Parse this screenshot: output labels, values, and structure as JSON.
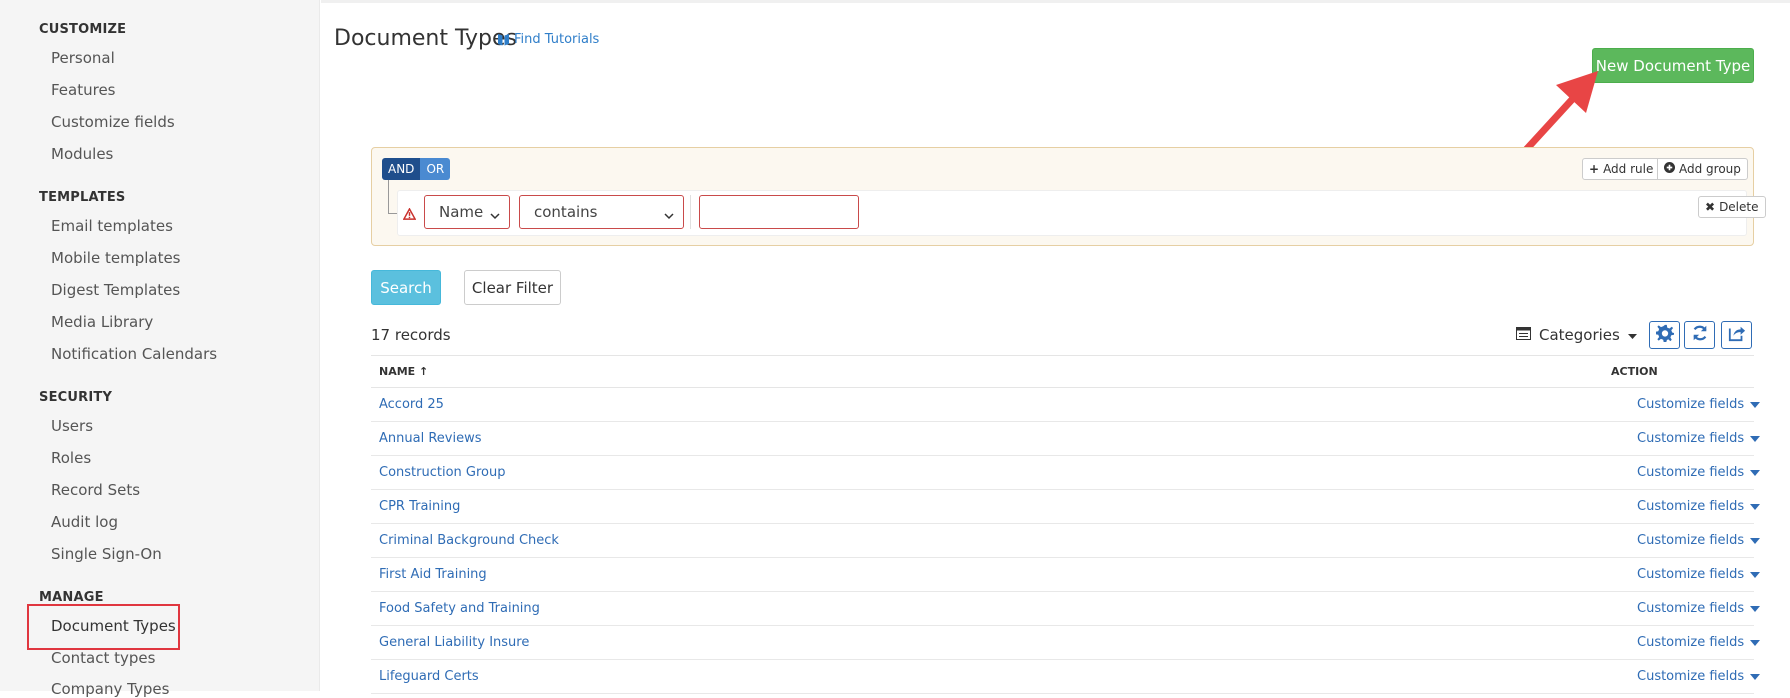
{
  "sidebar": {
    "sections": [
      {
        "heading": "CUSTOMIZE",
        "items": [
          "Personal",
          "Features",
          "Customize fields",
          "Modules"
        ]
      },
      {
        "heading": "TEMPLATES",
        "items": [
          "Email templates",
          "Mobile templates",
          "Digest Templates",
          "Media Library",
          "Notification Calendars"
        ]
      },
      {
        "heading": "SECURITY",
        "items": [
          "Users",
          "Roles",
          "Record Sets",
          "Audit log",
          "Single Sign-On"
        ]
      },
      {
        "heading": "MANAGE",
        "items": [
          "Document Types",
          "Contact types",
          "Company Types"
        ]
      }
    ]
  },
  "header": {
    "title": "Document Types",
    "tutorials_label": "Find Tutorials",
    "new_button_label": "New Document Type"
  },
  "query_builder": {
    "and_label": "AND",
    "or_label": "OR",
    "add_rule_label": "Add rule",
    "add_group_label": "Add group",
    "delete_label": "Delete",
    "field_value": "Name",
    "operator_value": "contains",
    "input_value": ""
  },
  "search": {
    "search_label": "Search",
    "clear_label": "Clear Filter"
  },
  "toolbar": {
    "records_label": "17 records",
    "categories_label": "Categories"
  },
  "table": {
    "col_name": "NAME ↑",
    "col_action": "ACTION",
    "rows": [
      {
        "name": "Accord 25",
        "action": "Customize fields"
      },
      {
        "name": "Annual Reviews",
        "action": "Customize fields"
      },
      {
        "name": "Construction Group",
        "action": "Customize fields"
      },
      {
        "name": "CPR Training",
        "action": "Customize fields"
      },
      {
        "name": "Criminal Background Check",
        "action": "Customize fields"
      },
      {
        "name": "First Aid Training",
        "action": "Customize fields"
      },
      {
        "name": "Food Safety and Training",
        "action": "Customize fields"
      },
      {
        "name": "General Liability Insure",
        "action": "Customize fields"
      },
      {
        "name": "Lifeguard Certs",
        "action": "Customize fields"
      }
    ]
  },
  "colors": {
    "accent": "#2f6cb5",
    "success": "#5cb85c",
    "info": "#5bc0de",
    "highlight": "#e0363f"
  }
}
